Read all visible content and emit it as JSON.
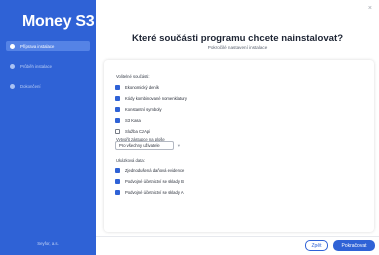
{
  "sidebar": {
    "brand": "Money S3",
    "steps": [
      {
        "label": "Příprava instalace",
        "active": true
      },
      {
        "label": "Průběh instalace",
        "active": false
      },
      {
        "label": "Dokončení",
        "active": false
      }
    ],
    "footer": "Seyfor, a.s."
  },
  "window": {
    "close_glyph": "×"
  },
  "main": {
    "title": "Které součásti programu chcete nainstalovat?",
    "subtitle": "Pokročilé nastavení instalace",
    "optional_heading": "Volitelné součásti:",
    "optional_items": [
      {
        "label": "Ekonomický deník",
        "checked": true
      },
      {
        "label": "Kódy kombinované nomenklatury",
        "checked": true
      },
      {
        "label": "Konstantní symboly",
        "checked": true
      },
      {
        "label": "S3 Kasa",
        "checked": true
      },
      {
        "label": "Služba CzApi",
        "checked": false
      }
    ],
    "access_label": "Vytvořit zástupce na ploše",
    "access_value": "Pro všechny uživatele",
    "sample_heading": "Ukázková data:",
    "sample_items": [
      {
        "label": "Zjednodušená daňová evidence",
        "checked": true
      },
      {
        "label": "Podvojné účetnictví se sklady B",
        "checked": true
      },
      {
        "label": "Podvojné účetnictví se sklady A",
        "checked": true
      }
    ]
  },
  "buttons": {
    "back": "Zpět",
    "next": "Pokračovat"
  },
  "colors": {
    "accent": "#2f62d6",
    "sidebar": "#2f62d6"
  }
}
